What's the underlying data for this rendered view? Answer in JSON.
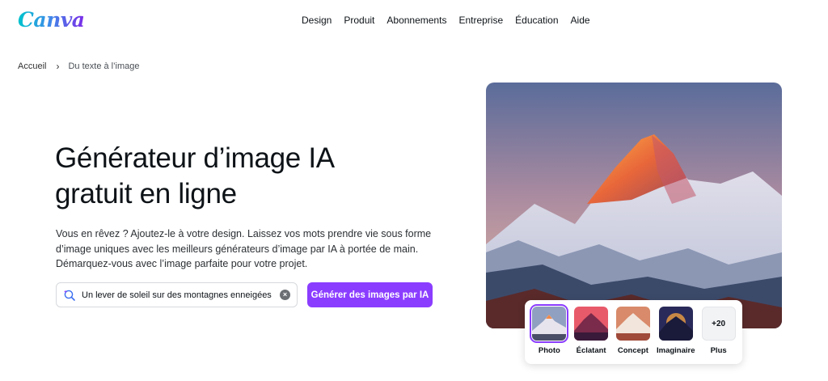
{
  "header": {
    "logo": "Canva",
    "nav": [
      "Design",
      "Produit",
      "Abonnements",
      "Entreprise",
      "Éducation",
      "Aide"
    ]
  },
  "breadcrumb": {
    "home": "Accueil",
    "current": "Du texte à l’image"
  },
  "hero": {
    "title_line1": "Générateur d’image IA",
    "title_line2": "gratuit en ligne",
    "description": "Vous en rêvez ? Ajoutez-le à votre design. Laissez vos mots prendre vie sous forme d’image uniques avec les meilleurs générateurs d’image par IA à portée de main. Démarquez-vous avec l’image parfaite pour votre projet.",
    "prompt_value": "Un lever de soleil sur des montagnes enneigées",
    "generate_button": "Générer des images par IA"
  },
  "styles": {
    "items": [
      "Photo",
      "Éclatant",
      "Concept",
      "Imaginaire",
      "Plus"
    ],
    "more_count": "+20",
    "selected": "Photo"
  },
  "colors": {
    "accent": "#8b3dff",
    "text": "#0e1318"
  }
}
